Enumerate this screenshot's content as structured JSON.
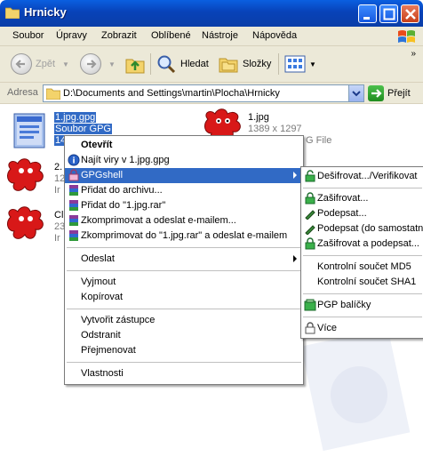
{
  "window": {
    "title": "Hrnicky"
  },
  "menubar": {
    "items": [
      "Soubor",
      "Úpravy",
      "Zobrazit",
      "Oblíbené",
      "Nástroje",
      "Nápověda"
    ]
  },
  "toolbar": {
    "back": "Zpět",
    "search": "Hledat",
    "folders": "Složky"
  },
  "address": {
    "label": "Adresa",
    "path": "D:\\Documents and Settings\\martin\\Plocha\\Hrnicky",
    "go": "Přejít"
  },
  "files": {
    "f1": {
      "name": "1.jpg.gpg",
      "type": "Soubor GPG",
      "extra": "14"
    },
    "f2": {
      "name": "1.jpg",
      "dims": "1389 x 1297",
      "type": "G File"
    },
    "f3": {
      "name": "2.",
      "size": "12",
      "type": "Ir"
    },
    "f4": {
      "name": "Cl",
      "size": "23",
      "type": "Ir"
    }
  },
  "context_menu": {
    "items": [
      "Otevřít",
      "Najít viry v 1.jpg.gpg",
      "GPGshell",
      "Přidat do archivu...",
      "Přidat do \"1.jpg.rar\"",
      "Zkomprimovat a odeslat e-mailem...",
      "Zkomprimovat do \"1.jpg.rar\" a odeslat e-mailem",
      "Odeslat",
      "Vyjmout",
      "Kopírovat",
      "Vytvořit zástupce",
      "Odstranit",
      "Přejmenovat",
      "Vlastnosti"
    ]
  },
  "submenu": {
    "items": [
      "Dešifrovat.../Verifikovat",
      "Zašifrovat...",
      "Podepsat...",
      "Podepsat (do samostatné",
      "Zašifrovat a podepsat...",
      "Kontrolní součet MD5",
      "Kontrolní součet SHA1",
      "PGP balíčky",
      "Více"
    ]
  },
  "colors": {
    "title_blue": "#0842b8",
    "highlight": "#316ac5",
    "chrome": "#ece9d8"
  },
  "icons": [
    "folder-icon",
    "back-icon",
    "forward-icon",
    "up-folder-icon",
    "search-icon",
    "folders-icon",
    "views-icon",
    "go-icon",
    "gpg-file-icon",
    "image-file-icon",
    "scan-icon",
    "rar-icon",
    "lock-icon",
    "pen-icon",
    "package-icon"
  ]
}
